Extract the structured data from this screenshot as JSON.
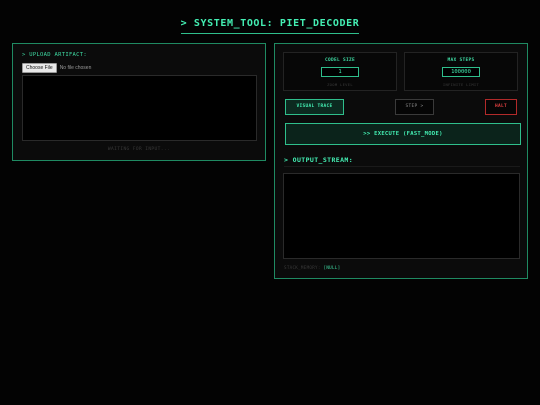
{
  "header": {
    "title": "> SYSTEM_TOOL: PIET_DECODER"
  },
  "upload_panel": {
    "label": "> UPLOAD ARTIFACT:",
    "choose_file_label": "Choose File",
    "file_status": "No file chosen",
    "waiting_text": "WAITING FOR INPUT..."
  },
  "config": {
    "codel_size": {
      "label": "CODEL SIZE",
      "value": "1",
      "hint": "ZOOM LEVEL"
    },
    "max_steps": {
      "label": "MAX STEPS",
      "value": "100000",
      "hint": "INFINITE LIMIT"
    }
  },
  "controls": {
    "visual_trace_label": "VISUAL TRACE",
    "step_label": "STEP >",
    "halt_label": "HALT",
    "execute_label": ">> EXECUTE (FAST_MODE)"
  },
  "output": {
    "title": "> OUTPUT_STREAM:",
    "stack_label": "STACK_MEMORY:",
    "stack_value": "[NULL]"
  },
  "colors": {
    "accent": "#44f0b4",
    "border": "#1f8a62",
    "halt": "#e04040",
    "background": "#030303"
  }
}
